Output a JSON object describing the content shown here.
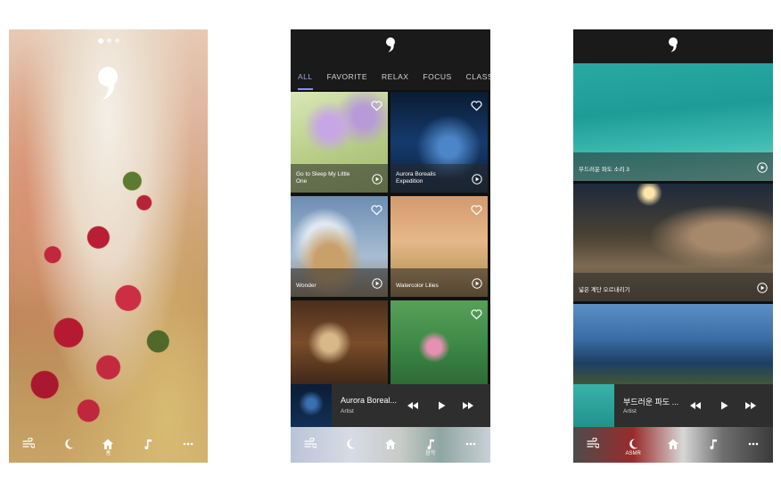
{
  "phone1": {
    "nav": [
      {
        "icon": "wind-icon",
        "label": ""
      },
      {
        "icon": "moon-icon",
        "label": ""
      },
      {
        "icon": "home-icon",
        "label": "홈"
      },
      {
        "icon": "music-note-icon",
        "label": ""
      },
      {
        "icon": "more-icon",
        "label": ""
      }
    ]
  },
  "phone2": {
    "tabs": [
      "ALL",
      "FAVORITE",
      "RELAX",
      "FOCUS",
      "CLASS"
    ],
    "tiles": [
      {
        "title": "Go to Sleep My Little One"
      },
      {
        "title": "Aurora Borealis Expedition"
      },
      {
        "title": "Wonder"
      },
      {
        "title": "Watercolor Lilies"
      }
    ],
    "player": {
      "title": "Aurora Boreal...",
      "artist": "Artist"
    },
    "nav": [
      {
        "icon": "wind-icon",
        "label": ""
      },
      {
        "icon": "moon-icon",
        "label": ""
      },
      {
        "icon": "home-icon",
        "label": ""
      },
      {
        "icon": "music-note-icon",
        "label": "음악"
      },
      {
        "icon": "more-icon",
        "label": ""
      }
    ]
  },
  "phone3": {
    "tiles": [
      {
        "title": "부드러운 파도 소리 3"
      },
      {
        "title": "넓은 계단 오르내리기"
      }
    ],
    "player": {
      "title": "부드러운 파도 ...",
      "artist": "Artist"
    },
    "nav": [
      {
        "icon": "wind-icon",
        "label": ""
      },
      {
        "icon": "moon-icon",
        "label": "ASMR"
      },
      {
        "icon": "home-icon",
        "label": ""
      },
      {
        "icon": "music-note-icon",
        "label": ""
      },
      {
        "icon": "more-icon",
        "label": ""
      }
    ]
  },
  "colors": {
    "accent": "#8e8ef0",
    "player_bg": "#2e2e2e",
    "bar_bg": "#1a1a1a"
  }
}
